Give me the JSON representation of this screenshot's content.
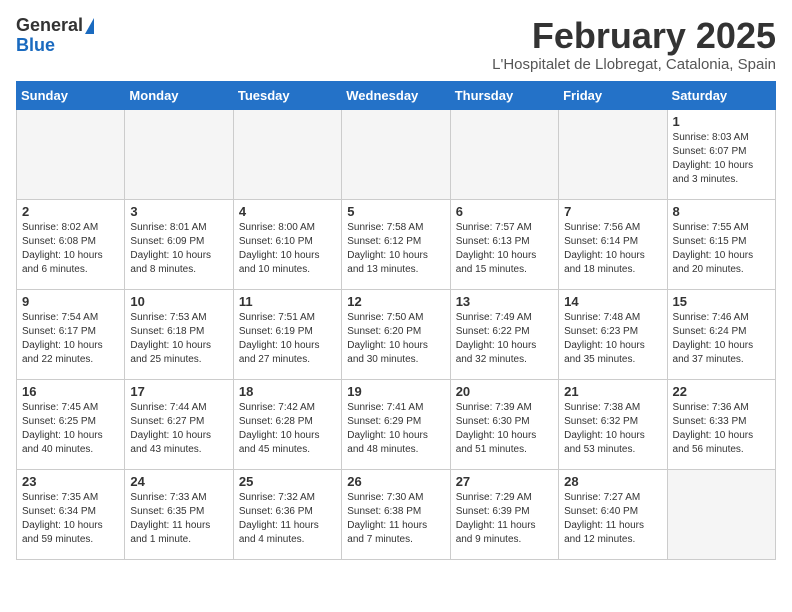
{
  "logo": {
    "general": "General",
    "blue": "Blue"
  },
  "title": {
    "month_year": "February 2025",
    "location": "L'Hospitalet de Llobregat, Catalonia, Spain"
  },
  "weekdays": [
    "Sunday",
    "Monday",
    "Tuesday",
    "Wednesday",
    "Thursday",
    "Friday",
    "Saturday"
  ],
  "weeks": [
    [
      {
        "day": "",
        "info": ""
      },
      {
        "day": "",
        "info": ""
      },
      {
        "day": "",
        "info": ""
      },
      {
        "day": "",
        "info": ""
      },
      {
        "day": "",
        "info": ""
      },
      {
        "day": "",
        "info": ""
      },
      {
        "day": "1",
        "info": "Sunrise: 8:03 AM\nSunset: 6:07 PM\nDaylight: 10 hours and 3 minutes."
      }
    ],
    [
      {
        "day": "2",
        "info": "Sunrise: 8:02 AM\nSunset: 6:08 PM\nDaylight: 10 hours and 6 minutes."
      },
      {
        "day": "3",
        "info": "Sunrise: 8:01 AM\nSunset: 6:09 PM\nDaylight: 10 hours and 8 minutes."
      },
      {
        "day": "4",
        "info": "Sunrise: 8:00 AM\nSunset: 6:10 PM\nDaylight: 10 hours and 10 minutes."
      },
      {
        "day": "5",
        "info": "Sunrise: 7:58 AM\nSunset: 6:12 PM\nDaylight: 10 hours and 13 minutes."
      },
      {
        "day": "6",
        "info": "Sunrise: 7:57 AM\nSunset: 6:13 PM\nDaylight: 10 hours and 15 minutes."
      },
      {
        "day": "7",
        "info": "Sunrise: 7:56 AM\nSunset: 6:14 PM\nDaylight: 10 hours and 18 minutes."
      },
      {
        "day": "8",
        "info": "Sunrise: 7:55 AM\nSunset: 6:15 PM\nDaylight: 10 hours and 20 minutes."
      }
    ],
    [
      {
        "day": "9",
        "info": "Sunrise: 7:54 AM\nSunset: 6:17 PM\nDaylight: 10 hours and 22 minutes."
      },
      {
        "day": "10",
        "info": "Sunrise: 7:53 AM\nSunset: 6:18 PM\nDaylight: 10 hours and 25 minutes."
      },
      {
        "day": "11",
        "info": "Sunrise: 7:51 AM\nSunset: 6:19 PM\nDaylight: 10 hours and 27 minutes."
      },
      {
        "day": "12",
        "info": "Sunrise: 7:50 AM\nSunset: 6:20 PM\nDaylight: 10 hours and 30 minutes."
      },
      {
        "day": "13",
        "info": "Sunrise: 7:49 AM\nSunset: 6:22 PM\nDaylight: 10 hours and 32 minutes."
      },
      {
        "day": "14",
        "info": "Sunrise: 7:48 AM\nSunset: 6:23 PM\nDaylight: 10 hours and 35 minutes."
      },
      {
        "day": "15",
        "info": "Sunrise: 7:46 AM\nSunset: 6:24 PM\nDaylight: 10 hours and 37 minutes."
      }
    ],
    [
      {
        "day": "16",
        "info": "Sunrise: 7:45 AM\nSunset: 6:25 PM\nDaylight: 10 hours and 40 minutes."
      },
      {
        "day": "17",
        "info": "Sunrise: 7:44 AM\nSunset: 6:27 PM\nDaylight: 10 hours and 43 minutes."
      },
      {
        "day": "18",
        "info": "Sunrise: 7:42 AM\nSunset: 6:28 PM\nDaylight: 10 hours and 45 minutes."
      },
      {
        "day": "19",
        "info": "Sunrise: 7:41 AM\nSunset: 6:29 PM\nDaylight: 10 hours and 48 minutes."
      },
      {
        "day": "20",
        "info": "Sunrise: 7:39 AM\nSunset: 6:30 PM\nDaylight: 10 hours and 51 minutes."
      },
      {
        "day": "21",
        "info": "Sunrise: 7:38 AM\nSunset: 6:32 PM\nDaylight: 10 hours and 53 minutes."
      },
      {
        "day": "22",
        "info": "Sunrise: 7:36 AM\nSunset: 6:33 PM\nDaylight: 10 hours and 56 minutes."
      }
    ],
    [
      {
        "day": "23",
        "info": "Sunrise: 7:35 AM\nSunset: 6:34 PM\nDaylight: 10 hours and 59 minutes."
      },
      {
        "day": "24",
        "info": "Sunrise: 7:33 AM\nSunset: 6:35 PM\nDaylight: 11 hours and 1 minute."
      },
      {
        "day": "25",
        "info": "Sunrise: 7:32 AM\nSunset: 6:36 PM\nDaylight: 11 hours and 4 minutes."
      },
      {
        "day": "26",
        "info": "Sunrise: 7:30 AM\nSunset: 6:38 PM\nDaylight: 11 hours and 7 minutes."
      },
      {
        "day": "27",
        "info": "Sunrise: 7:29 AM\nSunset: 6:39 PM\nDaylight: 11 hours and 9 minutes."
      },
      {
        "day": "28",
        "info": "Sunrise: 7:27 AM\nSunset: 6:40 PM\nDaylight: 11 hours and 12 minutes."
      },
      {
        "day": "",
        "info": ""
      }
    ]
  ]
}
